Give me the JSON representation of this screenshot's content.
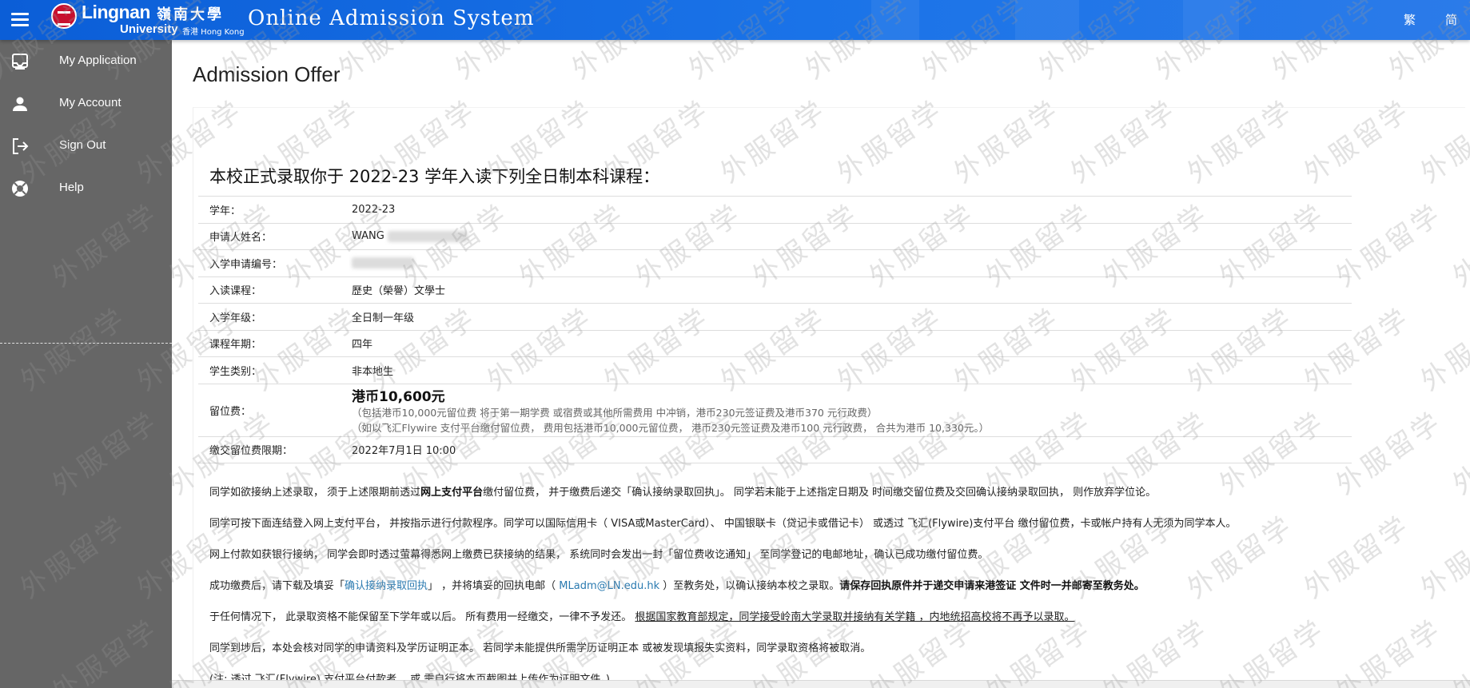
{
  "header": {
    "logo_en": "Lingnan",
    "logo_cn": "嶺南大學",
    "logo_sub_en": "University",
    "logo_sub_hk": "香港 Hong Kong",
    "system_title": "Online Admission System",
    "lang_traditional": "繁",
    "lang_simplified": "简",
    "color": "#1a73e8"
  },
  "sidebar": {
    "items": [
      {
        "label": "My Application",
        "icon": "inbox-icon"
      },
      {
        "label": "My Account",
        "icon": "person-icon"
      },
      {
        "label": "Sign Out",
        "icon": "logout-icon"
      },
      {
        "label": "Help",
        "icon": "help-icon"
      }
    ],
    "color": "#666666"
  },
  "main": {
    "title": "Admission Offer",
    "heading": "本校正式录取你于 2022-23 学年入读下列全日制本科课程：",
    "rows": [
      {
        "key": "学年：",
        "value": "2022-23"
      },
      {
        "key": "申请人姓名：",
        "value": "WANG"
      },
      {
        "key": "入学申请编号：",
        "value": ""
      },
      {
        "key": "入读课程：",
        "value": "歷史（榮譽）文學士"
      },
      {
        "key": "入学年级：",
        "value": "全日制一年级"
      },
      {
        "key": "课程年期：",
        "value": "四年"
      },
      {
        "key": "学生类别：",
        "value": "非本地生"
      }
    ],
    "fee": {
      "key": "留位费：",
      "amount": "港币10,600元",
      "note1": "（包括港币10,000元留位费 将于第一期学费 或宿费或其他所需费用 中冲销，港币230元签证费及港币370 元行政费）",
      "note2": "（如以飞汇Flywire 支付平台缴付留位费， 费用包括港币10,000元留位费， 港币230元签证费及港币100 元行政费， 合共为港币 10,330元。）"
    },
    "deadline": {
      "key": "缴交留位费限期：",
      "value": "2022年7月1日 10:00"
    },
    "notes": {
      "p1_a": "同学如欲接纳上述录取， 须于上述限期前透过",
      "p1_bold": "网上支付平台",
      "p1_b": "缴付留位费， 并于缴费后递交「确认接纳录取回执」。 同学若未能于上述指定日期及 时间缴交留位费及交回确认接纳录取回执， 则作放弃学位论。",
      "p2": "同学可按下面连结登入网上支付平台， 并按指示进行付款程序。同学可以国际信用卡（ VISA或MasterCard）、 中国银联卡（贷记卡或借记卡） 或透过 飞汇(Flywire)支付平台 缴付留位费，卡或帐户持有人无须为同学本人。",
      "p3": "网上付款如获银行接纳， 同学会即时透过萤幕得悉网上缴费已获接纳的结果， 系统同时会发出一封「留位费收讫通知」 至同学登记的电邮地址，确认已成功缴付留位费。",
      "p4_a": "成功缴费后，请下载及填妥「",
      "p4_link": "确认接纳录取回执",
      "p4_b": "」 ，并将填妥的回执电邮（ ",
      "p4_email": "MLadm@LN.edu.hk",
      "p4_c": " ）至教务处，以确认接纳本校之录取。",
      "p4_bold": "请保存回执原件并于递交申请来港签证 文件时一并邮寄至教务处。",
      "p5_a": "于任何情况下， 此录取资格不能保留至下学年或以后。 所有费用一经缴交，一律不予发还。 ",
      "p5_u": "根据国家教育部规定，同学接受岭南大学录取并接纳有关学籍 ，内地统招高校将不再予以录取。",
      "p6": "同学到埗后，本处会核对同学的申请资料及学历证明正本。 若同学未能提供所需学历证明正本 或被发现填报失实资料，同学录取资格将被取消。",
      "p7": "(注: 透过 飞汇(Flywire) 支付平台付款者， 或 需自行将本页截图并上传作为证明文件。)"
    },
    "watermark": "外服留学"
  }
}
